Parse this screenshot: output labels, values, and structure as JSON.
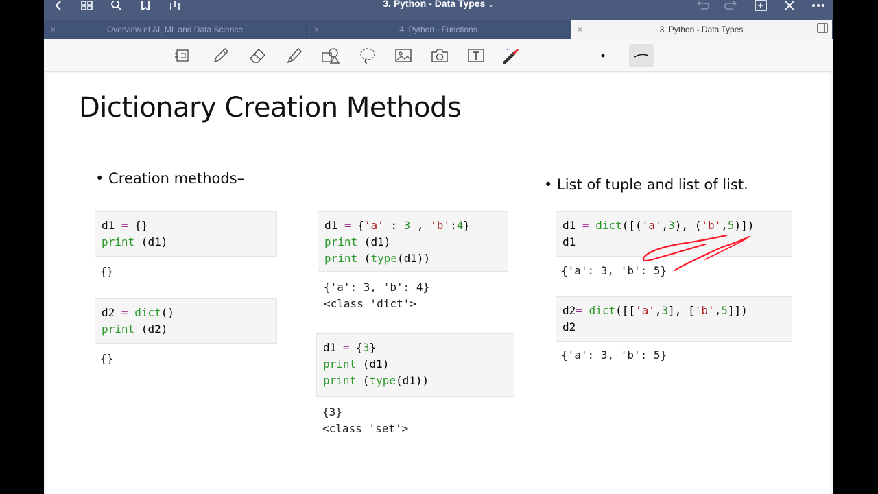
{
  "window": {
    "title": "3. Python - Data Types",
    "caret": "⌄"
  },
  "tabs": [
    {
      "label": "Overview of AI, ML and Data Science",
      "active": false
    },
    {
      "label": "4. Python - Functions",
      "active": false
    },
    {
      "label": "3. Python - Data Types",
      "active": true
    }
  ],
  "tab_close_glyph": "×",
  "titlebar_icons": {
    "left": [
      "back-icon",
      "grid-icon",
      "search-icon",
      "bookmark-icon",
      "share-icon"
    ],
    "right": [
      "undo-icon",
      "redo-icon",
      "add-page-icon",
      "close-icon",
      "more-icon"
    ]
  },
  "toolbar_icons": [
    "reading-mode-icon",
    "pen-icon",
    "eraser-icon",
    "highlighter-icon",
    "shapes-icon",
    "lasso-icon",
    "image-icon",
    "camera-icon",
    "text-icon",
    "laser-pointer-icon",
    "dot-icon",
    "stroke-width-icon"
  ],
  "slide": {
    "title": "Dictionary Creation Methods",
    "bullet_left": "• Creation methods–",
    "bullet_right": "• List of tuple and list of list.",
    "blocks": [
      {
        "code": [
          "d1 = {}",
          "print (d1)"
        ],
        "output": [
          "{}"
        ]
      },
      {
        "code": [
          "d2 = dict()",
          "print (d2)"
        ],
        "output": [
          "{}"
        ]
      },
      {
        "code": [
          "d1 = {'a' : 3 , 'b':4}",
          "print (d1)",
          "print (type(d1))"
        ],
        "output": [
          "{'a': 3, 'b': 4}",
          "<class 'dict'>"
        ]
      },
      {
        "code": [
          "d1 = {3}",
          "print (d1)",
          "print (type(d1))"
        ],
        "output": [
          "{3}",
          "<class 'set'>"
        ]
      },
      {
        "code": [
          "d1 = dict([('a',3), ('b',5)])",
          "d1"
        ],
        "output": [
          "{'a': 3, 'b': 5}"
        ]
      },
      {
        "code": [
          "d2= dict([['a',3], ['b',5]])",
          "d2"
        ],
        "output": [
          "{'a': 3, 'b': 5}"
        ]
      }
    ]
  },
  "colors": {
    "titlebar": "#4a5b7e",
    "keyword": "#2b9a2b",
    "operator": "#a0309a",
    "string": "#b02020",
    "annotation": "#ff1a2a"
  }
}
